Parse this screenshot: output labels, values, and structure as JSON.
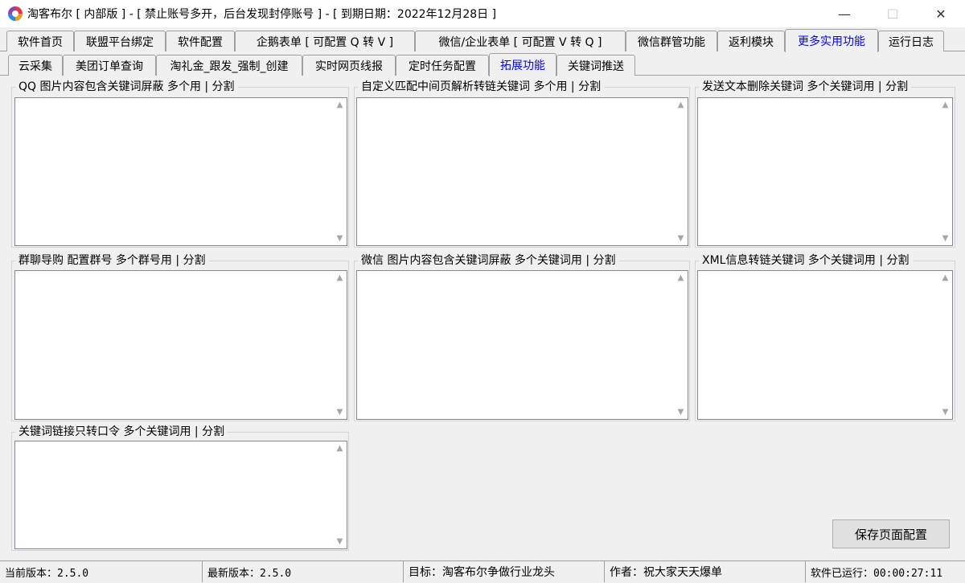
{
  "window": {
    "title": "淘客布尔 [ 内部版 ] - [ 禁止账号多开，后台发现封停账号 ] - [ 到期日期：2022年12月28日 ]",
    "minimize": "—",
    "maximize": "☐",
    "close": "✕"
  },
  "tabs_main": [
    {
      "label": "软件首页"
    },
    {
      "label": "联盟平台绑定"
    },
    {
      "label": "软件配置"
    },
    {
      "label": "企鹅表单 [ 可配置 Q 转 V ]"
    },
    {
      "label": "微信/企业表单 [ 可配置 V 转 Q ]"
    },
    {
      "label": "微信群管功能"
    },
    {
      "label": "返利模块"
    },
    {
      "label": "更多实用功能"
    },
    {
      "label": "运行日志"
    }
  ],
  "tabs_sub": [
    {
      "label": "云采集"
    },
    {
      "label": "美团订单查询"
    },
    {
      "label": "淘礼金_跟发_强制_创建"
    },
    {
      "label": "实时网页线报"
    },
    {
      "label": "定时任务配置"
    },
    {
      "label": "拓展功能"
    },
    {
      "label": "关键词推送"
    }
  ],
  "groups": [
    {
      "title": "QQ 图片内容包含关键词屏蔽  多个用 | 分割",
      "value": ""
    },
    {
      "title": "自定义匹配中间页解析转链关键词  多个用 | 分割",
      "value": ""
    },
    {
      "title": "发送文本删除关键词  多个关键词用 | 分割",
      "value": ""
    },
    {
      "title": "群聊导购 配置群号  多个群号用 | 分割",
      "value": ""
    },
    {
      "title": "微信 图片内容包含关键词屏蔽  多个关键词用 | 分割",
      "value": ""
    },
    {
      "title": "XML信息转链关键词  多个关键词用 | 分割",
      "value": ""
    },
    {
      "title": "关键词链接只转口令  多个关键词用 | 分割",
      "value": ""
    }
  ],
  "save_button": "保存页面配置",
  "status": {
    "current_version": "当前版本：2.5.0",
    "latest_version": "最新版本：2.5.0",
    "goal": "目标：淘客布尔争做行业龙头",
    "author": "作者：祝大家天天爆单",
    "runtime": "软件已运行：00:00:27:11"
  }
}
